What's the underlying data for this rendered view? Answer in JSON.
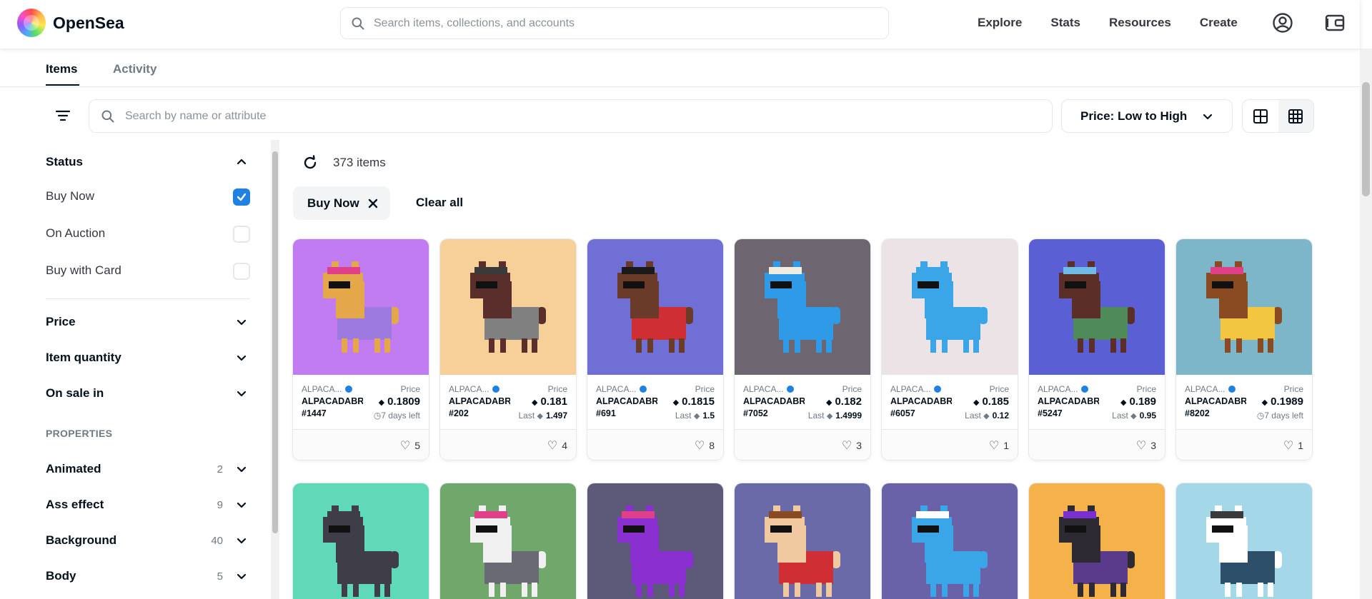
{
  "header": {
    "logo_text": "OpenSea",
    "search_placeholder": "Search items, collections, and accounts",
    "nav": [
      "Explore",
      "Stats",
      "Resources",
      "Create"
    ]
  },
  "tabs": [
    "Items",
    "Activity"
  ],
  "toolbar": {
    "attr_search_placeholder": "Search by name or attribute",
    "sort_label": "Price: Low to High"
  },
  "sidebar": {
    "status_title": "Status",
    "status_options": [
      {
        "label": "Buy Now",
        "checked": true
      },
      {
        "label": "On Auction",
        "checked": false
      },
      {
        "label": "Buy with Card",
        "checked": false
      }
    ],
    "sections": [
      "Price",
      "Item quantity",
      "On sale in"
    ],
    "properties_label": "PROPERTIES",
    "properties": [
      {
        "label": "Animated",
        "count": "2"
      },
      {
        "label": "Ass effect",
        "count": "9"
      },
      {
        "label": "Background",
        "count": "40"
      },
      {
        "label": "Body",
        "count": "5"
      }
    ]
  },
  "results": {
    "count_text": "373 items",
    "chip_label": "Buy Now",
    "clear_all": "Clear all"
  },
  "cards": [
    {
      "collection": "ALPACA...",
      "name": "ALPACADABRA",
      "id": "#1447",
      "price_label": "Price",
      "price": "0.1809",
      "sub_label": "7 days left",
      "sub_value": "",
      "likes": "5",
      "bg": "#c17cf2",
      "fur": "#e4a74a",
      "cloth": "#9c7ae0",
      "hat": "#e0408a"
    },
    {
      "collection": "ALPACA...",
      "name": "ALPACADABRA",
      "id": "#202",
      "price_label": "Price",
      "price": "0.181",
      "sub_label": "Last",
      "sub_value": "1.497",
      "likes": "4",
      "bg": "#f7cf98",
      "fur": "#5a2e2a",
      "cloth": "#808080",
      "hat": "#3a3a3a"
    },
    {
      "collection": "ALPACA...",
      "name": "ALPACADABRA",
      "id": "#691",
      "price_label": "Price",
      "price": "0.1815",
      "sub_label": "Last",
      "sub_value": "1.5",
      "likes": "8",
      "bg": "#6f6fd6",
      "fur": "#6b3b2a",
      "cloth": "#d02e35",
      "hat": "#1a1a1a"
    },
    {
      "collection": "ALPACA...",
      "name": "ALPACADABRA",
      "id": "#7052",
      "price_label": "Price",
      "price": "0.182",
      "sub_label": "Last",
      "sub_value": "1.4999",
      "likes": "3",
      "bg": "#6d6570",
      "fur": "#2f9be8",
      "cloth": "#2f9be8",
      "hat": "#f0ede0"
    },
    {
      "collection": "ALPACA...",
      "name": "ALPACADABRA",
      "id": "#6057",
      "price_label": "Price",
      "price": "0.185",
      "sub_label": "Last",
      "sub_value": "0.12",
      "likes": "1",
      "bg": "#ece3e6",
      "fur": "#3aa6e8",
      "cloth": "#3aa6e8",
      "hat": "#3aa6e8"
    },
    {
      "collection": "ALPACA...",
      "name": "ALPACADABRA",
      "id": "#5247",
      "price_label": "Price",
      "price": "0.189",
      "sub_label": "Last",
      "sub_value": "0.95",
      "likes": "3",
      "bg": "#5b5fd4",
      "fur": "#5c2e28",
      "cloth": "#4f8a5a",
      "hat": "#6fb9e6"
    },
    {
      "collection": "ALPACA...",
      "name": "ALPACADABRA",
      "id": "#8202",
      "price_label": "Price",
      "price": "0.1989",
      "sub_label": "7 days left",
      "sub_value": "",
      "likes": "1",
      "bg": "#7cb6c8",
      "fur": "#8a4a22",
      "cloth": "#f2c640",
      "hat": "#e0408a"
    }
  ],
  "cards_row2": [
    {
      "bg": "#5fd9b8",
      "fur": "#3e3d48",
      "cloth": "#3e3d48",
      "hat": "#3e3d48"
    },
    {
      "bg": "#6fa86a",
      "fur": "#f0f0f0",
      "cloth": "#6a6a74",
      "hat": "#e0408a"
    },
    {
      "bg": "#5c5a78",
      "fur": "#8a2fd0",
      "cloth": "#8a2fd0",
      "hat": "#e0408a"
    },
    {
      "bg": "#6a6aa8",
      "fur": "#f0c9a0",
      "cloth": "#d02e35",
      "hat": "#8a4a22"
    },
    {
      "bg": "#6a62a8",
      "fur": "#3aa6e8",
      "cloth": "#3aa6e8",
      "hat": "#ffffff"
    },
    {
      "bg": "#f5b24a",
      "fur": "#2e2a34",
      "cloth": "#5a3a8a",
      "hat": "#7a2fd0"
    },
    {
      "bg": "#a4d8e8",
      "fur": "#ffffff",
      "cloth": "#2d4f6a",
      "hat": "#3a3a3a"
    }
  ]
}
